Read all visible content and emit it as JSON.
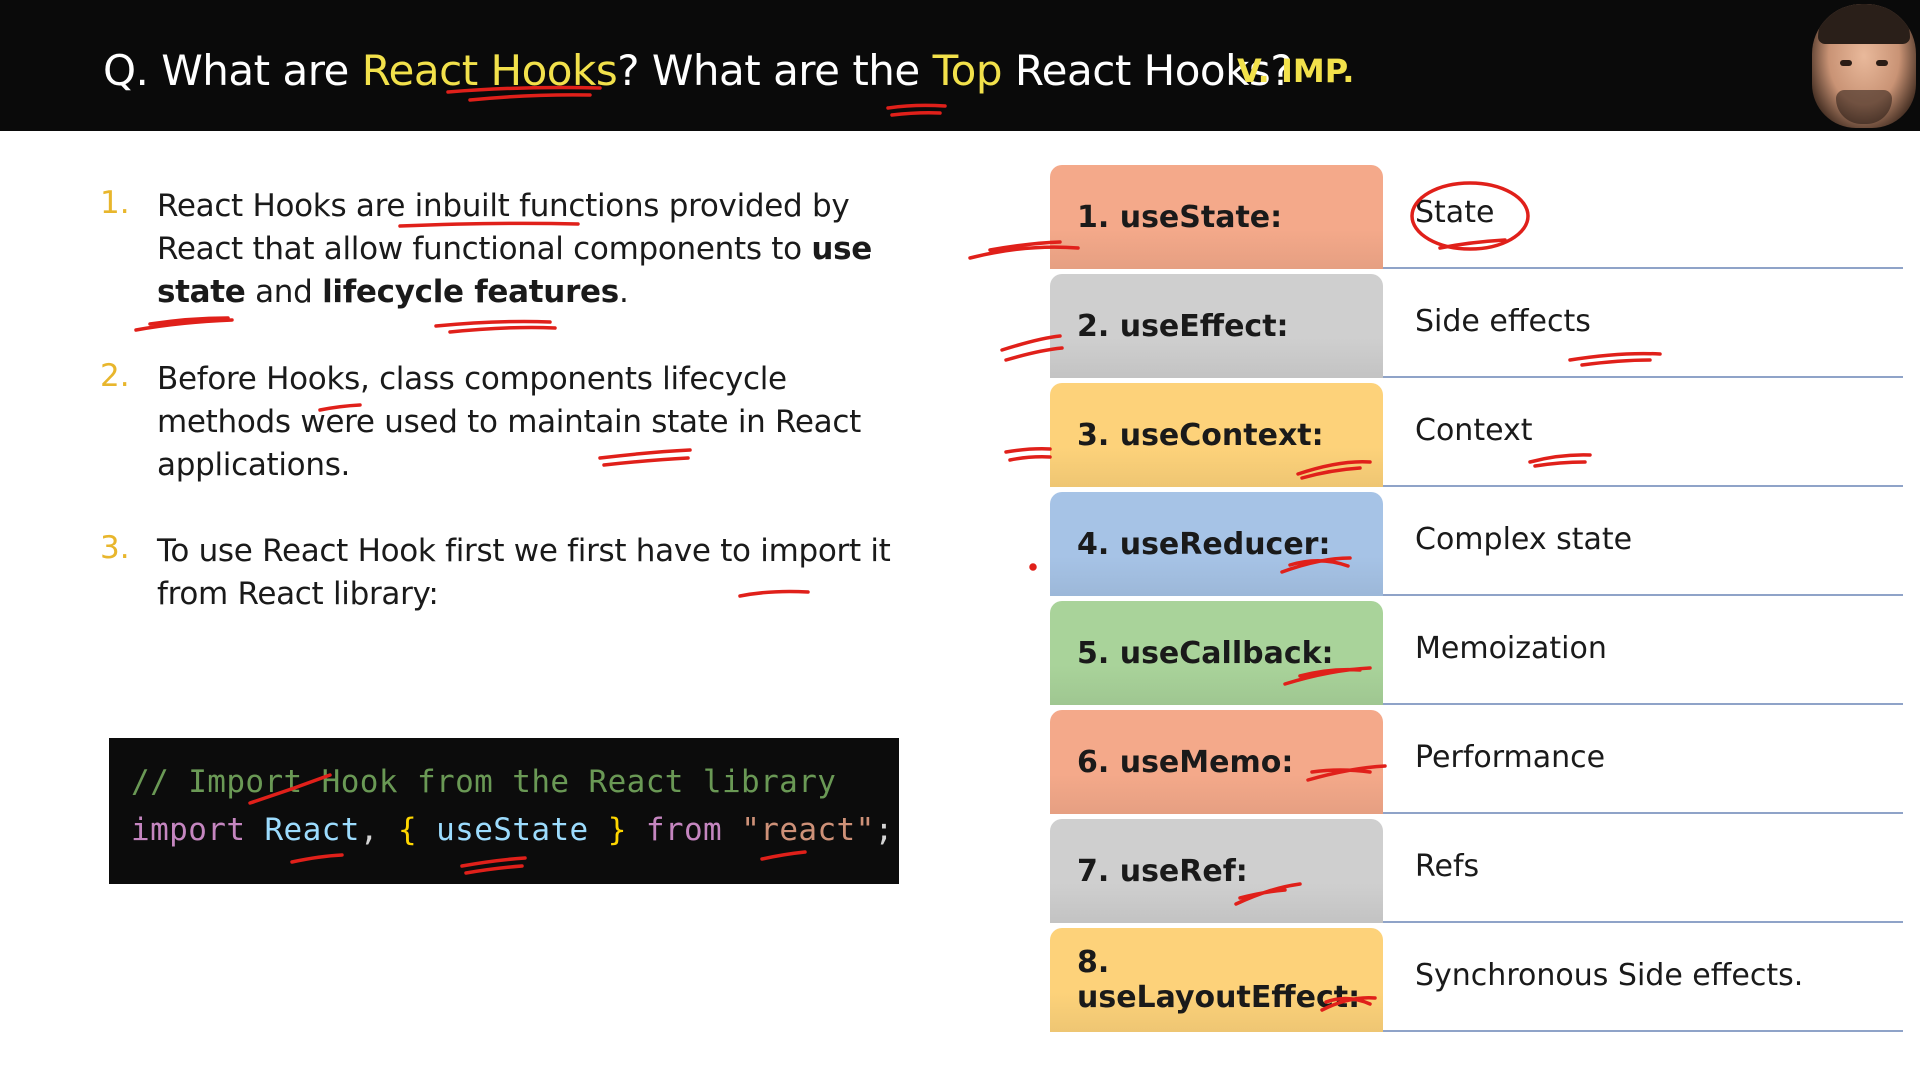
{
  "header": {
    "q_prefix": "Q. What are ",
    "q_react_hooks": "React Hooks",
    "q_middle": "? What are the ",
    "q_top": "Top",
    "q_suffix": " React Hooks?",
    "importance": "V. IMP."
  },
  "points": [
    {
      "number": "1.",
      "t1": "React Hooks are inbuilt functions provided by React that allow functional components to ",
      "b1": "use state",
      "t2": " and ",
      "b2": "lifecycle features",
      "t3": "."
    },
    {
      "number": "2.",
      "text": "Before Hooks, class components lifecycle methods were used to maintain state in React applications."
    },
    {
      "number": "3.",
      "text": "To use React Hook first we first have to import it from React library:"
    }
  ],
  "code": {
    "comment": "// Import Hook from the React library",
    "kw_import": "import",
    "id_react": "React",
    "comma": ",",
    "brace_open": "{",
    "id_usestate": "useState",
    "brace_close": "}",
    "kw_from": "from",
    "str_react": "\"react\"",
    "semicolon": ";"
  },
  "hooks": [
    {
      "name": "1. useState:",
      "desc": "State",
      "color": "#f4a98a"
    },
    {
      "name": "2. useEffect:",
      "desc": "Side effects",
      "color": "#cfcfcf"
    },
    {
      "name": "3. useContext:",
      "desc": "Context",
      "color": "#fdd27a"
    },
    {
      "name": "4. useReducer:",
      "desc": "Complex state",
      "color": "#a6c3e6"
    },
    {
      "name": "5. useCallback:",
      "desc": "Memoization",
      "color": "#a9d39a"
    },
    {
      "name": "6. useMemo:",
      "desc": "Performance",
      "color": "#f4a98a"
    },
    {
      "name": "7. useRef:",
      "desc": "Refs",
      "color": "#cfcfcf"
    },
    {
      "name": "8. useLayoutEffect:",
      "desc": "Synchronous Side effects.",
      "color": "#fdd27a"
    }
  ],
  "colors": {
    "header_bg": "#0a0a0a",
    "highlight": "#f2e14b",
    "number": "#e8b62c",
    "annotation": "#e0201a",
    "rule": "#8fa3c8"
  }
}
